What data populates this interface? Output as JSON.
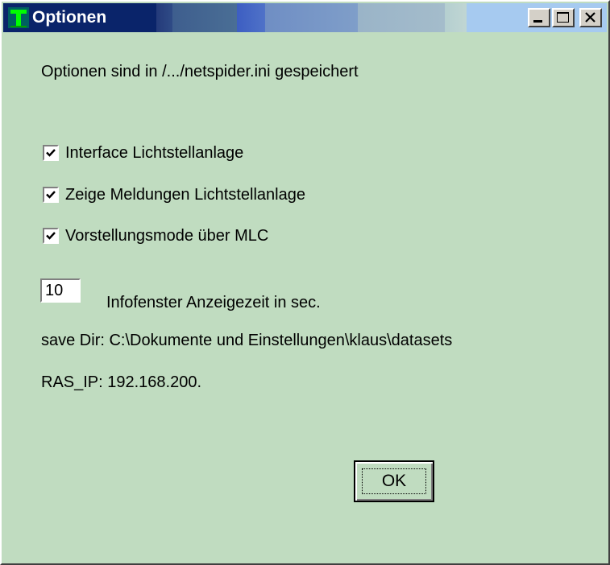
{
  "window": {
    "title": "Optionen",
    "app_icon": "tree-t-icon",
    "controls": [
      "minimize-icon",
      "maximize-icon",
      "close-icon"
    ]
  },
  "content": {
    "info_text": "Optionen sind in /.../netspider.ini gespeichert",
    "checkboxes": [
      {
        "label": "Interface Lichtstellanlage",
        "checked": true
      },
      {
        "label": "Zeige Meldungen Lichtstellanlage",
        "checked": true
      },
      {
        "label": "Vorstellungsmode über MLC",
        "checked": true
      }
    ],
    "info_duration": {
      "value": "10",
      "label": "Infofenster Anzeigezeit in sec."
    },
    "save_dir": "save Dir: C:\\Dokumente und Einstellungen\\klaus\\datasets",
    "ras_ip": "RAS_IP: 192.168.200."
  },
  "buttons": {
    "ok_label": "OK"
  },
  "colors": {
    "background": "#c0dcc0",
    "title_start": "#0a246a",
    "title_end": "#a6caf0",
    "app_icon": "#00ff00"
  }
}
